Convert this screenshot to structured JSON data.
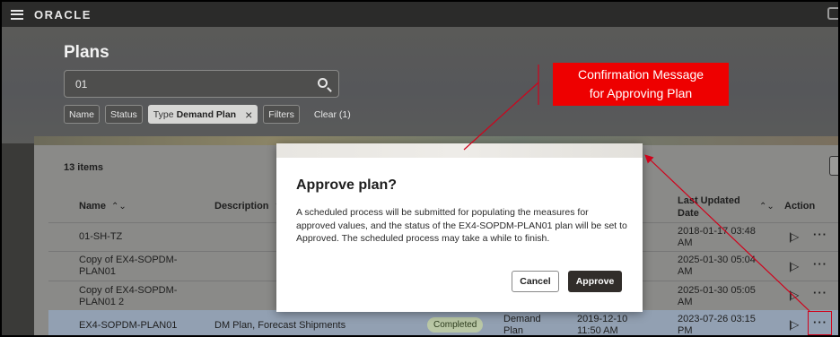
{
  "topbar": {
    "brand": "ORACLE"
  },
  "page": {
    "title": "Plans"
  },
  "search": {
    "value": "01"
  },
  "filters": {
    "name": "Name",
    "status": "Status",
    "type_label": "Type",
    "type_value": "Demand Plan",
    "filters": "Filters",
    "clear": "Clear (1)"
  },
  "table": {
    "count": "13 items",
    "headers": {
      "name": "Name",
      "description": "Description",
      "last_updated_1": "Last Updated",
      "last_updated_2": "Date",
      "action": "Action"
    },
    "rows": [
      {
        "name": "01-SH-TZ",
        "updated_1": "2018-01-17 03:48",
        "updated_2": "AM"
      },
      {
        "name_1": "Copy of EX4-SOPDM-",
        "name_2": "PLAN01",
        "updated_1": "2025-01-30 05:04",
        "updated_2": "AM"
      },
      {
        "name_1": "Copy of EX4-SOPDM-",
        "name_2": "PLAN01 2",
        "updated_1": "2025-01-30 05:05",
        "updated_2": "AM"
      },
      {
        "name": "EX4-SOPDM-PLAN01",
        "description": "DM Plan, Forecast Shipments",
        "status": "Completed",
        "type_1": "Demand",
        "type_2": "Plan",
        "date_1": "2019-12-10",
        "date_2": "11:50 AM",
        "updated_1": "2023-07-26 03:15",
        "updated_2": "PM"
      }
    ]
  },
  "dialog": {
    "title": "Approve plan?",
    "body": "A scheduled process will be submitted for populating the measures for approved values, and the status of the EX4-SOPDM-PLAN01 plan will be set to Approved. The scheduled process may take a while to finish.",
    "cancel": "Cancel",
    "approve": "Approve"
  },
  "callout": {
    "line1": "Confirmation Message",
    "line2": "for Approving Plan"
  },
  "colors": {
    "callout": "#ee0000",
    "approve_button": "#312d2a",
    "highlight": "#d0021b"
  }
}
